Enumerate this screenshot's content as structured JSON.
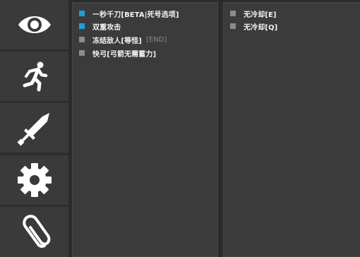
{
  "sidebar": {
    "items": [
      {
        "icon": "eye-icon",
        "active": false
      },
      {
        "icon": "running-person-icon",
        "active": false
      },
      {
        "icon": "sword-icon",
        "active": false
      },
      {
        "icon": "gear-icon",
        "active": false
      },
      {
        "icon": "paperclip-icon",
        "active": false
      }
    ]
  },
  "left_panel": {
    "options": [
      {
        "label": "一秒千刀[BETA|死号选项]",
        "enabled": true
      },
      {
        "label": "双重攻击",
        "enabled": true
      },
      {
        "label": "冻结敌人[等怪]",
        "hotkey": "[END]",
        "enabled": false
      },
      {
        "label": "快弓[弓箭无需蓄力]",
        "enabled": false
      }
    ]
  },
  "right_panel": {
    "options": [
      {
        "label": "无冷却[E]",
        "enabled": false
      },
      {
        "label": "无冷却[Q]",
        "enabled": false
      }
    ]
  },
  "colors": {
    "enabled": "#1e9fd6",
    "disabled": "#8c8c8c",
    "panel": "#3b3b3b",
    "background": "#2b2b2b"
  }
}
